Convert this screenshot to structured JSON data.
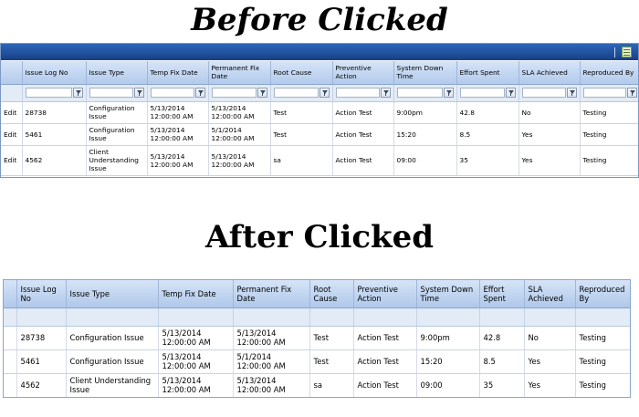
{
  "headings": {
    "before": "Before Clicked",
    "after": "After Clicked"
  },
  "before": {
    "toolbar_icon": "grid-settings-icon",
    "columns": [
      "",
      "Issue Log No",
      "Issue Type",
      "Temp Fix Date",
      "Permanent Fix Date",
      "Root Cause",
      "Preventive Action",
      "System Down Time",
      "Effort Spent",
      "SLA Achieved",
      "Reproduced By"
    ],
    "rows": [
      {
        "edit": "Edit",
        "log": "28738",
        "type": "Configuration Issue",
        "temp": "5/13/2014 12:00:00 AM",
        "perm": "5/13/2014 12:00:00 AM",
        "root": "Test",
        "action": "Action Test",
        "down": "9:00pm",
        "effort": "42.8",
        "sla": "No",
        "repro": "Testing"
      },
      {
        "edit": "Edit",
        "log": "5461",
        "type": "Configuration Issue",
        "temp": "5/13/2014 12:00:00 AM",
        "perm": "5/1/2014 12:00:00 AM",
        "root": "Test",
        "action": "Action Test",
        "down": "15:20",
        "effort": "8.5",
        "sla": "Yes",
        "repro": "Testing"
      },
      {
        "edit": "Edit",
        "log": "4562",
        "type": "Client Understanding Issue",
        "temp": "5/13/2014 12:00:00 AM",
        "perm": "5/13/2014 12:00:00 AM",
        "root": "sa",
        "action": "Action Test",
        "down": "09:00",
        "effort": "35",
        "sla": "Yes",
        "repro": "Testing"
      }
    ]
  },
  "after": {
    "columns": [
      "",
      "Issue Log No",
      "Issue Type",
      "Temp Fix Date",
      "Permanent Fix Date",
      "Root Cause",
      "Preventive Action",
      "System Down Time",
      "Effort Spent",
      "SLA Achieved",
      "Reproduced By"
    ],
    "rows": [
      {
        "log": "28738",
        "type": "Configuration Issue",
        "temp": "5/13/2014 12:00:00 AM",
        "perm": "5/13/2014 12:00:00 AM",
        "root": "Test",
        "action": "Action Test",
        "down": "9:00pm",
        "effort": "42.8",
        "sla": "No",
        "repro": "Testing"
      },
      {
        "log": "5461",
        "type": "Configuration Issue",
        "temp": "5/13/2014 12:00:00 AM",
        "perm": "5/1/2014 12:00:00 AM",
        "root": "Test",
        "action": "Action Test",
        "down": "15:20",
        "effort": "8.5",
        "sla": "Yes",
        "repro": "Testing"
      },
      {
        "log": "4562",
        "type": "Client Understanding Issue",
        "temp": "5/13/2014 12:00:00 AM",
        "perm": "5/13/2014 12:00:00 AM",
        "root": "sa",
        "action": "Action Test",
        "down": "09:00",
        "effort": "35",
        "sla": "Yes",
        "repro": "Testing"
      }
    ]
  }
}
